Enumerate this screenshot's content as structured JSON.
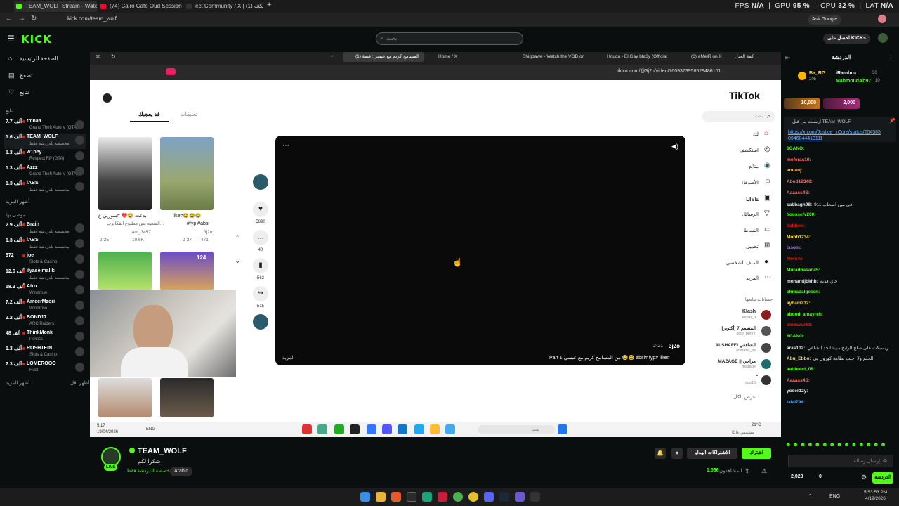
{
  "browser": {
    "tabs": [
      {
        "label": "TEAM_WOLF Stream - Watc",
        "color": "#53fc18"
      },
      {
        "label": "(74) Cairo Café Oud Session 2 -",
        "color": "#ff0033"
      },
      {
        "label": "ect Community / X | (1) ريسبكت",
        "color": "#222222"
      }
    ],
    "new_tab": "+",
    "url": "kick.com/team_wolf",
    "ask_google": "Ask Google"
  },
  "stats": {
    "fps_label": "FPS",
    "fps": "N/A",
    "gpu_label": "GPU",
    "gpu": "95 %",
    "cpu_label": "CPU",
    "cpu": "32 %",
    "lat_label": "LAT",
    "lat": "N/A"
  },
  "kick": {
    "logo": "KICK",
    "search_placeholder": "بحث",
    "get_kicks": "احصل على KICKs"
  },
  "sidebar": {
    "nav": [
      {
        "icon": "⌂",
        "label": "الصفحة الرئيسية"
      },
      {
        "icon": "▤",
        "label": "تصفح"
      },
      {
        "icon": "♡",
        "label": "تتابع"
      }
    ],
    "following_header": "تتابع",
    "following": [
      {
        "count": "7.7 ألف",
        "name": "tmnaa",
        "game": "Grand Theft Auto V (GTA)"
      },
      {
        "count": "1.6 ألف",
        "name": "TEAM_WOLF",
        "game": "مخصصة للدردشة فقط"
      },
      {
        "count": "1.3 ألف",
        "name": "w1pey",
        "game": "Respect RP (GTA)"
      },
      {
        "count": "1.3 ألف",
        "name": "Azzz",
        "game": "Grand Theft Auto V (GTA)"
      },
      {
        "count": "1.3 ألف",
        "name": "iABS",
        "game": "مخصصة للدردشة فقط"
      }
    ],
    "show_more_1": "أظهر المزيد",
    "recommended_header": "موصى بها",
    "recommended": [
      {
        "count": "2.9 ألف",
        "name": "Brain",
        "game": "مخصصة للدردشة فقط"
      },
      {
        "count": "1.3 ألف",
        "name": "iABS",
        "game": "مخصصة للدردشة فقط"
      },
      {
        "count": "372",
        "name": "joe",
        "game": "Slots & Casino"
      },
      {
        "count": "12.6 ألف",
        "name": "ilyaselmaliki",
        "game": "مخصصة للدردشة فقط"
      },
      {
        "count": "18.2 ألف",
        "name": "Atro",
        "game": "Windrose"
      },
      {
        "count": "7.2 ألف",
        "name": "AmeerMzori",
        "game": "Windrose"
      },
      {
        "count": "2.2 ألف",
        "name": "BOND17",
        "game": "ARC Raiders"
      },
      {
        "count": "48 ألف",
        "name": "ThinkMonk",
        "game": "Politics"
      },
      {
        "count": "1.3 ألف",
        "name": "ROSHTEIN",
        "game": "Slots & Casino"
      },
      {
        "count": "2.3 ألف",
        "name": "LOMEROOO",
        "game": "Rust"
      }
    ],
    "show_more_2": "أظهر المزيد",
    "show_less": "أظهر أقل"
  },
  "inner_browser": {
    "tabs": [
      "(المسامح كريم مع عبسي: قصة (1",
      "Home / X",
      "Shiqbawe - Watch the VOD or",
      "Houda - El Gay bta3y (Official",
      "(6) aMeiR on X",
      "كمة العدل"
    ],
    "url": "tiktok.com/@3j2o/video/7609373958529486101"
  },
  "tiktok": {
    "logo": "TikTok",
    "left_tabs": {
      "active": "قد يعجبك",
      "other": "تعليقات"
    },
    "thumbs": [
      {
        "caption": "ابدعت 😂❤️ #سوريي ع",
        "caption2": "السعيه بس مطنوع القكاترب...",
        "author": "tam_3457",
        "date": "2-25",
        "views": "10.6K"
      },
      {
        "caption": "like#😂😂😂",
        "caption2": "#fyp #absi",
        "author": "3j2o",
        "date": "2-27",
        "views": "471"
      }
    ],
    "thumb_badge": "124",
    "actions": [
      {
        "icon": "♥",
        "count": "5890"
      },
      {
        "icon": "…",
        "count": "40"
      },
      {
        "icon": "▮",
        "count": "562"
      },
      {
        "icon": "↪",
        "count": "515"
      }
    ],
    "video": {
      "author": "3j2o",
      "date": "2-21",
      "caption": "Part 1 من المسامح كريم مع عبسي 😂😂 absi# fyp# like#",
      "more": "المزيد"
    },
    "right_nav": [
      {
        "icon": "⌂",
        "label": "لك"
      },
      {
        "icon": "◎",
        "label": "استكشف"
      },
      {
        "icon": "◉",
        "label": "متابَع"
      },
      {
        "icon": "☺",
        "label": "الأصدقاء"
      },
      {
        "icon": "▣",
        "label": "LIVE"
      },
      {
        "icon": "▽",
        "label": "الرسائل"
      },
      {
        "icon": "▭",
        "label": "النشاط"
      },
      {
        "icon": "⊞",
        "label": "تحميل"
      },
      {
        "icon": "●",
        "label": "الملف الشخصي"
      },
      {
        "icon": "⋯",
        "label": "المزيد"
      }
    ],
    "following_header": "حسابات تتابعها",
    "following": [
      {
        "name": "Klash",
        "handle": "klash_rl"
      },
      {
        "name": "المصمم 7 [أكتوبر]",
        "handle": "octo_ber77"
      },
      {
        "name": "ALSHAFEI الشافعي",
        "handle": "alshafei_ps"
      },
      {
        "name": "MAZAGE || مزاجي",
        "handle": "mazage"
      },
      {
        "name": "ً",
        "handle": "just13"
      }
    ],
    "show_all": "عرض الكل",
    "search_placeholder": "بحث"
  },
  "inner_taskbar": {
    "time": "5:17",
    "date": "19/04/2026",
    "lang": "ENG",
    "search": "بحث",
    "weather": "21°C",
    "weather_desc": "مشمس غالبًا"
  },
  "channel": {
    "name": "TEAM_WOLF",
    "title": "شكرا لكم",
    "category": "مخصصة للدردشة فقط",
    "language": "Arabic",
    "live_badge": "LIVE",
    "subscribe": "اشترك",
    "gift": "الاشتراكات الهدايا",
    "viewers": "1,566",
    "viewers_label": "المشاهدون"
  },
  "chat": {
    "title": "الدردشة",
    "top": [
      {
        "name": "Ba_RG",
        "amount": "205"
      },
      {
        "name": "iRambox",
        "amount": "30"
      },
      {
        "name": "MahmoudAb97",
        "amount": "10"
      }
    ],
    "gifts": [
      "10,000",
      "2,000"
    ],
    "pinned_by": "أرسلت من قبل TEAM_WOLF",
    "pinned_link": "https://x.com/Justice_xCore/status/2045850946844413111",
    "messages": [
      {
        "user": "6GANO:",
        "text": "",
        "color": "#53fc18"
      },
      {
        "user": "moferas10:",
        "text": "",
        "color": "#ff6b6b"
      },
      {
        "user": "anuanj:",
        "text": "",
        "color": "#ffb84d"
      },
      {
        "user": "Abod12340:",
        "text": "",
        "color": "#ff6b6b"
      },
      {
        "user": "Aaaass4S:",
        "text": "",
        "color": "#ff6b6b"
      },
      {
        "user": "sabbagh98:",
        "text": "911 في مين اصحاب",
        "color": "#e8e8e8"
      },
      {
        "user": "Youssefv200:",
        "text": "",
        "color": "#53fc18"
      },
      {
        "user": "dahlene:",
        "text": "",
        "color": "#e91916"
      },
      {
        "user": "Mohb1234:",
        "text": "",
        "color": "#ffd84d"
      },
      {
        "user": "Issom:",
        "text": "",
        "color": "#b388ff"
      },
      {
        "user": "Tiers4x:",
        "text": "",
        "color": "#e91916"
      },
      {
        "user": "Muradhasan45:",
        "text": "",
        "color": "#53fc18"
      },
      {
        "user": "mohandjbkhb:",
        "text": "حاي قديه",
        "color": "#e8e8e8"
      },
      {
        "user": "ahmadalgesen:",
        "text": "",
        "color": "#53fc18"
      },
      {
        "user": "ayham232:",
        "text": "",
        "color": "#ffd84d"
      },
      {
        "user": "abood_amayreh:",
        "text": "",
        "color": "#53fc18"
      },
      {
        "user": "dinosaur68:",
        "text": "",
        "color": "#e91916"
      },
      {
        "user": "6GANO:",
        "text": "",
        "color": "#53fc18"
      },
      {
        "user": "aras102:",
        "text": "ريسبكت على صلح الرابح مبيشا حد الشاعي",
        "color": "#e8e8e8"
      },
      {
        "user": "Abu_Ebbo:",
        "text": "الحلم ولا احبب لطامة كهرول بي",
        "color": "#ffd84d"
      },
      {
        "user": "aabbood_08:",
        "text": "",
        "color": "#53fc18"
      },
      {
        "user": "Aaaass4S:",
        "text": "",
        "color": "#ff6b6b"
      },
      {
        "user": "yoser12y:",
        "text": "",
        "color": "#e8e8e8"
      },
      {
        "user": "talal794:",
        "text": "",
        "color": "#4da6ff"
      }
    ],
    "input_placeholder": "إرسال رسالة",
    "points": "2,020",
    "points2": "0",
    "send": "الدردشة"
  },
  "windows": {
    "lang": "ENG",
    "time": "5:53:53 PM",
    "date": "4/19/2026"
  }
}
